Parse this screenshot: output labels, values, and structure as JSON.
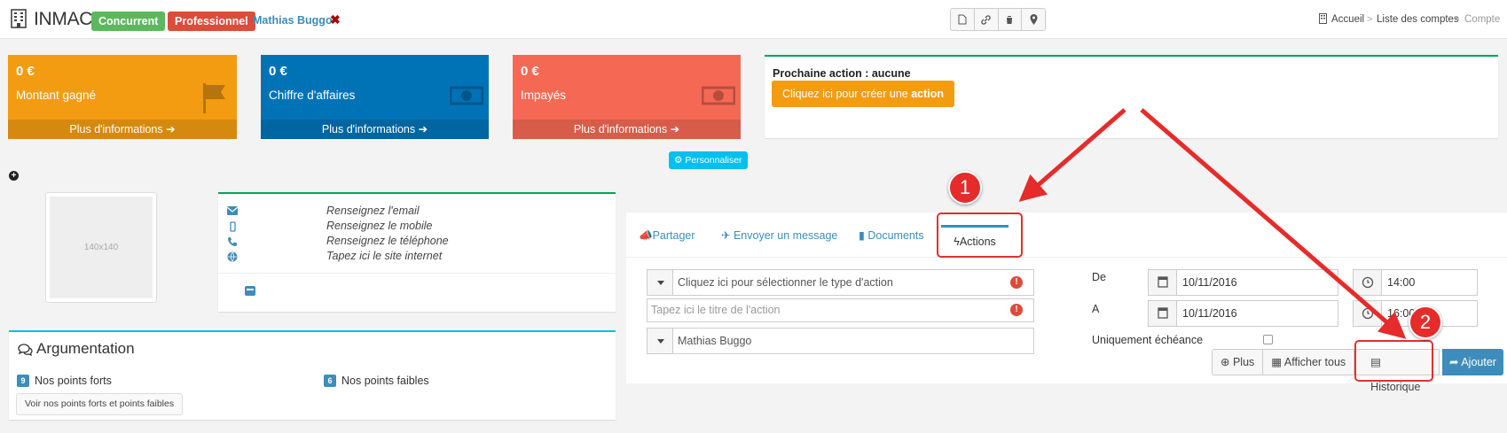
{
  "header": {
    "company": "INMAC",
    "label_green": "Concurrent",
    "label_red": "Professionnel",
    "person": "Mathias Buggo",
    "breadcrumb": [
      "Accueil",
      "Liste des comptes",
      "Compte"
    ],
    "breadcrumb_sep": ">"
  },
  "stats": [
    {
      "amount": "0 €",
      "label": "Montant gagné",
      "more": "Plus d'informations",
      "color": "#f39c12",
      "icon": "flag-icon"
    },
    {
      "amount": "0 €",
      "label": "Chiffre d'affaires",
      "more": "Plus d'informations",
      "color": "#0073b7",
      "icon": "money-icon"
    },
    {
      "amount": "0 €",
      "label": "Impayés",
      "more": "Plus d'informations",
      "color": "#f56954",
      "icon": "money-icon"
    }
  ],
  "next_action": {
    "title": "Prochaine action : aucune",
    "button_text": "Cliquez ici pour créer une",
    "button_bold": "action"
  },
  "personnaliser": "Personnaliser",
  "avatar_placeholder": "140x140",
  "contact": {
    "email": "Renseignez l'email",
    "mobile": "Renseignez le mobile",
    "phone": "Renseignez le téléphone",
    "website": "Tapez ici le site internet"
  },
  "argumentation": {
    "title": "Argumentation",
    "strong_count": "9",
    "strong_label": "Nos points forts",
    "weak_count": "6",
    "weak_label": "Nos points faibles",
    "button": "Voir nos points forts et points faibles"
  },
  "tabs": {
    "share": "Partager",
    "message": "Envoyer un message",
    "documents": "Documents",
    "actions": "Actions"
  },
  "action_form": {
    "type_placeholder": "Cliquez ici pour sélectionner le type d'action",
    "title_placeholder": "Tapez ici le titre de l'action",
    "assignee": "Mathias Buggo",
    "from_label": "De",
    "to_label": "A",
    "date_from": "10/11/2016",
    "time_from": "14:00",
    "date_to": "10/11/2016",
    "time_to": "16:00",
    "deadline_only": "Uniquement échéance",
    "btn_more": "Plus",
    "btn_show_all": "Afficher tous",
    "btn_history": "Historique",
    "btn_add": "Ajouter"
  },
  "annotations": {
    "marker1": "1",
    "marker2": "2",
    "color": "#e62b2b"
  }
}
